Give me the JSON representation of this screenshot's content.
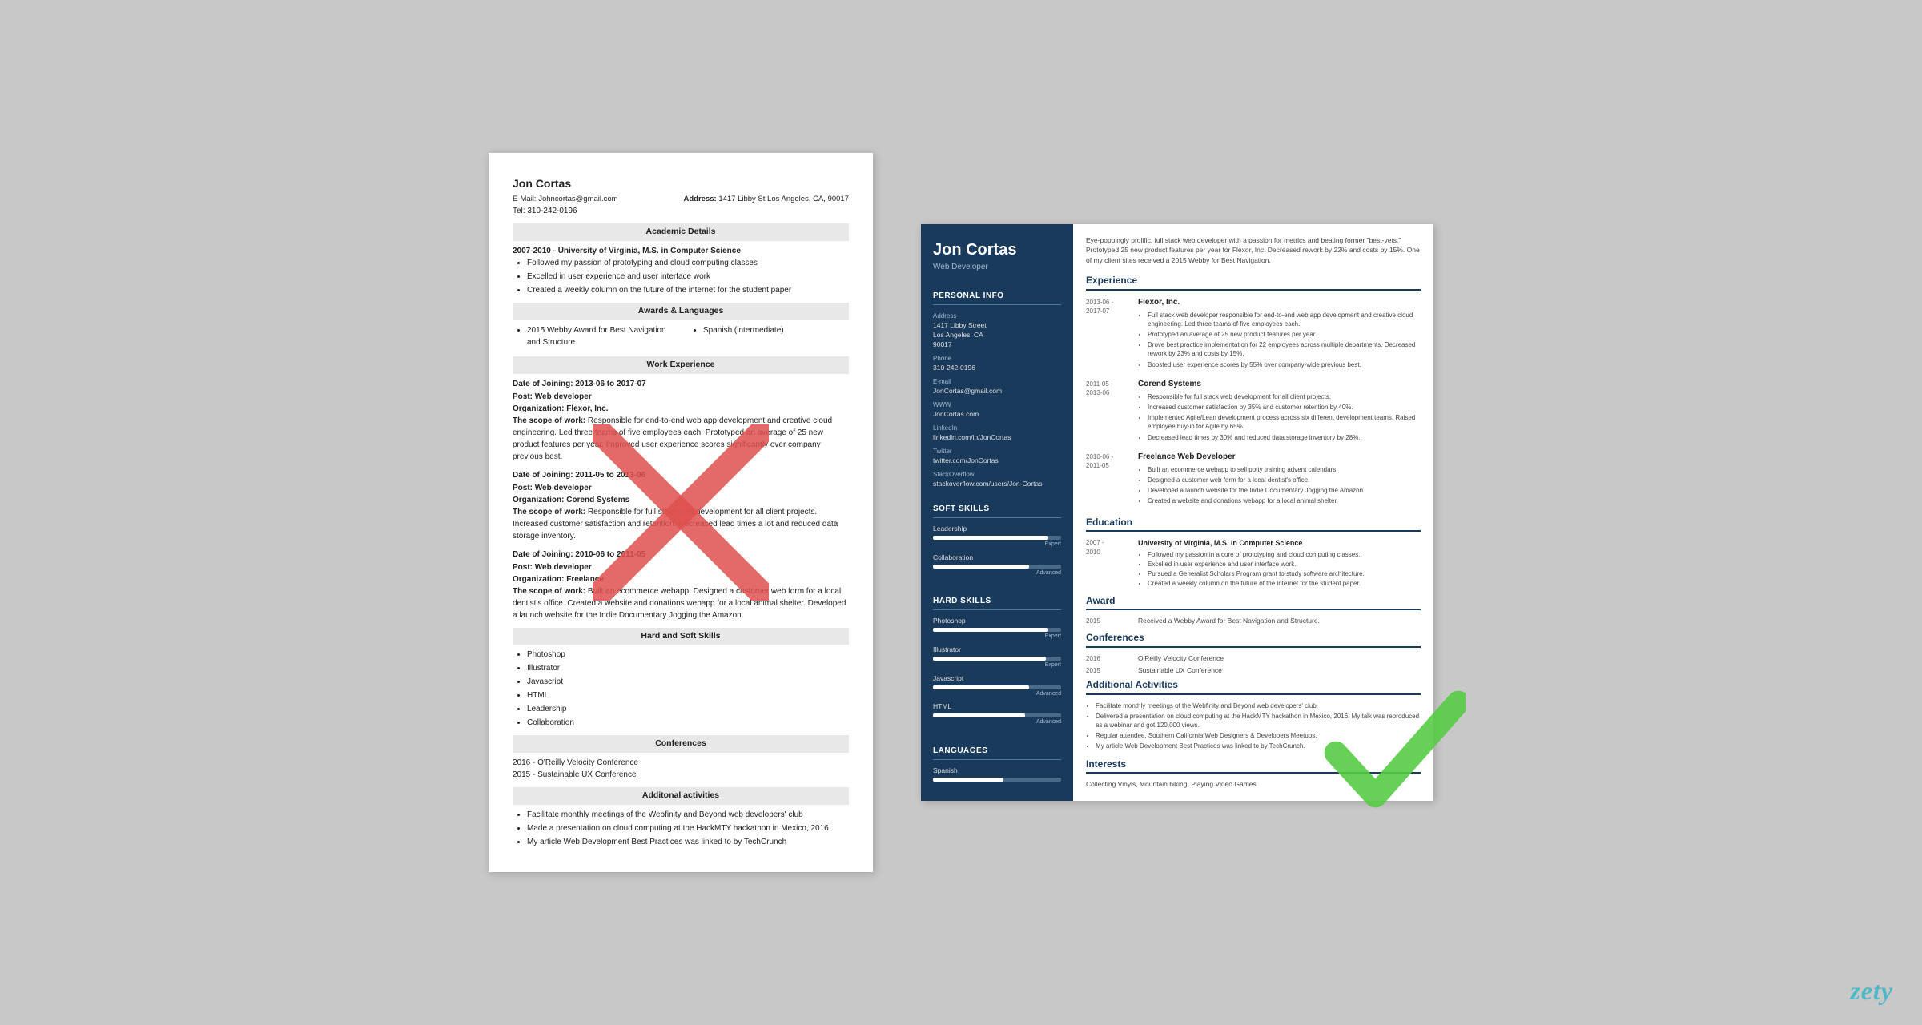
{
  "plain_resume": {
    "name": "Jon Cortas",
    "email": "E-Mail: Johncortas@gmail.com",
    "address_label": "Address:",
    "address": "1417 Libby St Los Angeles, CA, 90017",
    "tel": "Tel: 310-242-0196",
    "sections": {
      "academic": "Academic Details",
      "academic_entry": "2007-2010 - University of Virginia, M.S. in Computer Science",
      "academic_bullets": [
        "Followed my passion of prototyping and cloud computing classes",
        "Excelled in user experience and user interface work",
        "Created a weekly column on the future of the internet for the student paper"
      ],
      "awards": "Awards & Languages",
      "award1": "2015 Webby Award for Best Navigation and Structure",
      "lang1": "Spanish (intermediate)",
      "work": "Work Experience",
      "job1_date": "Date of Joining: 2013-06 to 2017-07",
      "job1_post": "Post:",
      "job1_post_val": "Web developer",
      "job1_org": "Organization:",
      "job1_org_val": "Flexor, Inc.",
      "job1_scope": "The scope of work:",
      "job1_scope_text": "Responsible for end-to-end web app development and creative cloud engineering. Led three teams of five employees each. Prototyped an average of 25 new product features per year. Improved user experience scores significantly over company previous best.",
      "job2_date": "Date of Joining: 2011-05 to 2013-06",
      "job2_post": "Post:",
      "job2_post_val": "Web developer",
      "job2_org": "Organization:",
      "job2_org_val": "Corend Systems",
      "job2_scope": "The scope of work:",
      "job2_scope_text": "Responsible for full stack web development for all client projects. Increased customer satisfaction and retention. Decreased lead times a lot and reduced data storage inventory.",
      "job3_date": "Date of Joining: 2010-06 to 2011-05",
      "job3_post": "Post:",
      "job3_post_val": "Web developer",
      "job3_org": "Organization:",
      "job3_org_val": "Freelance",
      "job3_scope": "The scope of work:",
      "job3_scope_text": "Built an ecommerce webapp. Designed a customer web form for a local dentist's office. Created a website and donations webapp for a local animal shelter. Developed a launch website for the Indie Documentary Jogging the Amazon.",
      "skills": "Hard and Soft Skills",
      "skills_list": [
        "Photoshop",
        "Illustrator",
        "Javascript",
        "HTML",
        "Leadership",
        "Collaboration"
      ],
      "conferences": "Conferences",
      "conf1": "2016 - O'Reilly Velocity Conference",
      "conf2": "2015 - Sustainable UX Conference",
      "activities": "Additonal activities",
      "act1": "Facilitate monthly meetings of the Webfinity and Beyond web developers' club",
      "act2": "Made a presentation on cloud computing at the HackMTY hackathon in Mexico, 2016",
      "act3": "My article Web Development Best Practices was linked to by TechCrunch"
    }
  },
  "designed_resume": {
    "name": "Jon Cortas",
    "title": "Web Developer",
    "summary": "Eye-poppingly prolific, full stack web developer with a passion for metrics and beating former \"best-yets.\" Prototyped 25 new product features per year for Flexor, Inc. Decreased rework by 22% and costs by 15%. One of my client sites received a 2015 Webby for Best Navigation.",
    "sidebar": {
      "personal_info_label": "Personal Info",
      "address_label": "Address",
      "address": "1417 Libby Street",
      "city": "Los Angeles, CA",
      "zip": "90017",
      "phone_label": "Phone",
      "phone": "310-242-0196",
      "email_label": "E-mail",
      "email": "JonCortas@gmail.com",
      "www_label": "WWW",
      "www": "JonCortas.com",
      "linkedin_label": "LinkedIn",
      "linkedin": "linkedin.com/in/JonCortas",
      "twitter_label": "Twitter",
      "twitter": "twitter.com/JonCortas",
      "stackoverflow_label": "StackOverflow",
      "stackoverflow": "stackoverflow.com/users/Jon-Cortas",
      "soft_skills_label": "Soft Skills",
      "soft_skills": [
        {
          "name": "Leadership",
          "level": "Expert",
          "pct": 90
        },
        {
          "name": "Collaboration",
          "level": "Advanced",
          "pct": 75
        }
      ],
      "hard_skills_label": "Hard Skills",
      "hard_skills": [
        {
          "name": "Photoshop",
          "level": "Expert",
          "pct": 90
        },
        {
          "name": "Illustrator",
          "level": "Expert",
          "pct": 88
        },
        {
          "name": "Javascript",
          "level": "Advanced",
          "pct": 75
        },
        {
          "name": "HTML",
          "level": "Advanced",
          "pct": 72
        }
      ],
      "languages_label": "Languages",
      "languages": [
        {
          "name": "Spanish",
          "level": "",
          "pct": 55
        }
      ]
    },
    "main": {
      "experience_label": "Experience",
      "jobs": [
        {
          "dates": "2013-06 -\n2017-07",
          "company": "Flexor, Inc.",
          "bullets": [
            "Full stack web developer responsible for end-to-end web app development and creative cloud engineering. Led three teams of five employees each.",
            "Prototyped an average of 25 new product features per year.",
            "Drove best practice implementation for 22 employees across multiple departments. Decreased rework by 23% and costs by 15%.",
            "Boosted user experience scores by 55% over company-wide previous best."
          ]
        },
        {
          "dates": "2011-05 -\n2013-06",
          "company": "Corend Systems",
          "bullets": [
            "Responsible for full stack web development for all client projects.",
            "Increased customer satisfaction by 35% and customer retention by 40%.",
            "Implemented Agile/Lean development process across six different development teams. Raised employee buy-in for Agile by 65%.",
            "Decreased lead times by 30% and reduced data storage inventory by 28%."
          ]
        },
        {
          "dates": "2010-06 -\n2011-05",
          "company": "Freelance Web Developer",
          "bullets": [
            "Built an ecommerce webapp to sell potty training advent calendars.",
            "Designed a customer web form for a local dentist's office.",
            "Developed a launch website for the Indie Documentary Jogging the Amazon.",
            "Created a website and donations webapp for a local animal shelter."
          ]
        }
      ],
      "education_label": "Education",
      "education": [
        {
          "dates": "2007 -\n2010",
          "title": "University of Virginia, M.S. in Computer Science",
          "bullets": [
            "Followed my passion in a core of prototyping and cloud computing classes.",
            "Excelled in user experience and user interface work.",
            "Pursued a Generalist Scholars Program grant to study software architecture.",
            "Created a weekly column on the future of the internet for the student paper."
          ]
        }
      ],
      "award_label": "Award",
      "award_year": "2015",
      "award_text": "Received a Webby Award for Best Navigation and Structure.",
      "conferences_label": "Conferences",
      "conferences": [
        {
          "year": "2016",
          "name": "O'Reilly Velocity Conference"
        },
        {
          "year": "2015",
          "name": "Sustainable UX Conference"
        }
      ],
      "activities_label": "Additional Activities",
      "activities": [
        "Facilitate monthly meetings of the Webfinity and Beyond web developers' club.",
        "Delivered a presentation on cloud computing at the HackMTY hackathon in Mexico, 2016. My talk was reproduced as a webinar and got 120,000 views.",
        "Regular attendee, Southern California Web Designers & Developers Meetups.",
        "My article Web Development Best Practices was linked to by TechCrunch."
      ],
      "interests_label": "Interests",
      "interests": "Collecting Vinyls, Mountain biking, Playing Video Games"
    }
  },
  "zety": "zety"
}
